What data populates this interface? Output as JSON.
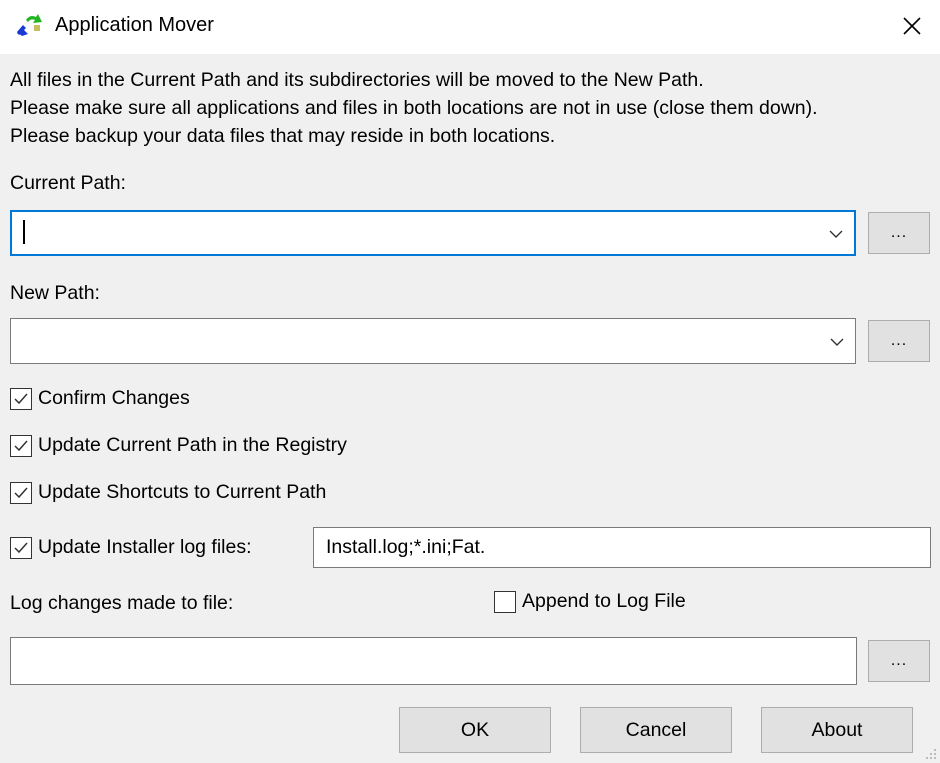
{
  "window": {
    "title": "Application Mover",
    "icon": "application-mover-icon",
    "close_icon": "close-icon"
  },
  "intro": {
    "lines": [
      "All files in the Current Path and its subdirectories will be moved to the New Path.",
      "Please make sure all applications and files in both locations are not in use (close them down).",
      "Please backup your data files that may reside in both locations."
    ]
  },
  "current_path": {
    "label": "Current Path:",
    "value": "",
    "browse_label": "..."
  },
  "new_path": {
    "label": "New Path:",
    "value": "",
    "browse_label": "..."
  },
  "options": {
    "confirm_changes": {
      "label": "Confirm Changes",
      "checked": true
    },
    "update_registry": {
      "label": "Update Current Path in the Registry",
      "checked": true
    },
    "update_shortcuts": {
      "label": "Update Shortcuts to Current Path",
      "checked": true
    },
    "update_installer_logs": {
      "label": "Update Installer log files:",
      "checked": true,
      "value": "Install.log;*.ini;Fat."
    }
  },
  "log": {
    "label": "Log changes made to file:",
    "append_label": "Append to Log File",
    "append_checked": false,
    "value": "",
    "browse_label": "..."
  },
  "buttons": {
    "ok": "OK",
    "cancel": "Cancel",
    "about": "About"
  },
  "colors": {
    "focus_border": "#0078d7",
    "dialog_bg": "#f0f0f0",
    "button_bg": "#e1e1e1"
  }
}
